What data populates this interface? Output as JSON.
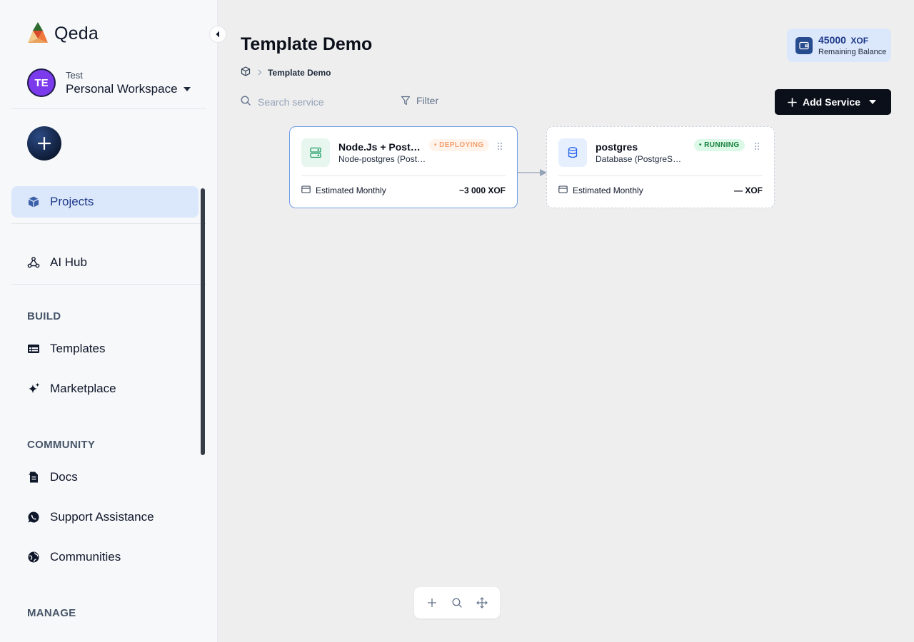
{
  "app": {
    "name": "Qeda"
  },
  "workspace": {
    "avatar_initials": "TE",
    "label": "Test",
    "name": "Personal Workspace"
  },
  "sidebar": {
    "projects": "Projects",
    "ai_hub": "AI Hub",
    "sections": {
      "build": "BUILD",
      "community": "COMMUNITY",
      "manage": "MANAGE"
    },
    "build_items": [
      "Templates",
      "Marketplace"
    ],
    "community_items": [
      "Docs",
      "Support Assistance",
      "Communities"
    ]
  },
  "page": {
    "title": "Template Demo",
    "breadcrumb": "Template Demo"
  },
  "balance": {
    "amount": "45000",
    "currency": "XOF",
    "label": "Remaining Balance"
  },
  "toolbar": {
    "search_placeholder": "Search service",
    "filter_label": "Filter",
    "add_service_label": "Add Service"
  },
  "services": [
    {
      "title": "Node.Js + Postgres",
      "subtitle": "Node-postgres (PostgreSQL)",
      "status": "• DEPLOYING",
      "estimate_label": "Estimated Monthly",
      "price": "~3 000 XOF"
    },
    {
      "title": "postgres",
      "subtitle": "Database (PostgreSQL)",
      "status": "• RUNNING",
      "estimate_label": "Estimated Monthly",
      "price": "— XOF"
    }
  ],
  "colors": {
    "accent": "#1e3a8a",
    "active_nav_bg": "#dbe7fb",
    "deploying": "#f4a06e",
    "running": "#15803d",
    "primary_button": "#0a0f1a"
  },
  "icons": {
    "logo": "qeda-logo-icon",
    "collapse": "chevron-left-icon",
    "projects": "cube-icon",
    "ai_hub": "webhook-icon",
    "templates": "table-icon",
    "marketplace": "sparkles-icon",
    "docs": "document-icon",
    "support": "whatsapp-icon",
    "communities": "globe-icon"
  }
}
